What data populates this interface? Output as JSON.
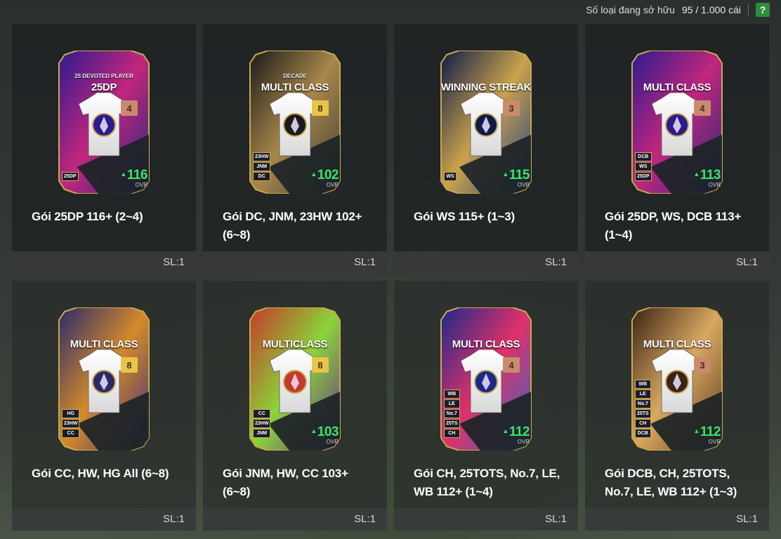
{
  "header": {
    "owned_label": "Số loại đang sở hữu",
    "owned_count": "95 / 1.000 cái",
    "help_label": "?"
  },
  "cards": [
    {
      "name": "Gói 25DP 116+ (2~4)",
      "pack_title": "25DP",
      "pack_sub": "25 DEVOTED PLAYER",
      "grade": "4",
      "ovr": "116",
      "ovr_label": "OVR",
      "tags": [
        "25DP"
      ],
      "quantity": "SL:1",
      "theme": [
        "#2c1b8f",
        "#c2267e",
        "#1b2a7a"
      ],
      "grade_color": "#c98b6b"
    },
    {
      "name": "Gói DC, JNM, 23HW 102+ (6~8)",
      "pack_title": "MULTI CLASS",
      "pack_sub": "DECADE",
      "grade": "8",
      "ovr": "102",
      "ovr_label": "OVR",
      "tags": [
        "23HW",
        "JNM",
        "DC"
      ],
      "quantity": "SL:1",
      "theme": [
        "#1a1a1a",
        "#a8874a",
        "#3a3a3a"
      ],
      "grade_color": "#e8c547"
    },
    {
      "name": "Gói WS 115+ (1~3)",
      "pack_title": "WINNING STREAK",
      "pack_sub": "",
      "grade": "3",
      "ovr": "115",
      "ovr_label": "OVR",
      "tags": [
        "WS"
      ],
      "quantity": "SL:1",
      "theme": [
        "#0e1a4a",
        "#c9a24a",
        "#1c3a8a"
      ],
      "grade_color": "#c98b6b"
    },
    {
      "name": "Gói 25DP, WS, DCB 113+ (1~4)",
      "pack_title": "MULTI CLASS",
      "pack_sub": "",
      "grade": "4",
      "ovr": "113",
      "ovr_label": "OVR",
      "tags": [
        "DCB",
        "WS",
        "25DP"
      ],
      "quantity": "SL:1",
      "theme": [
        "#2c1b8f",
        "#c2267e",
        "#1b2a7a"
      ],
      "grade_color": "#c98b6b"
    },
    {
      "name": "Gói CC, HW, HG All (6~8)",
      "pack_title": "MULTI CLASS",
      "pack_sub": "",
      "grade": "8",
      "ovr": "",
      "ovr_label": "",
      "tags": [
        "HG",
        "23HW",
        "CC"
      ],
      "quantity": "SL:1",
      "theme": [
        "#2a2a6a",
        "#d48a2a",
        "#3a2a7a"
      ],
      "grade_color": "#e8c547"
    },
    {
      "name": "Gói JNM, HW, CC 103+ (6~8)",
      "pack_title": "MULTICLASS",
      "pack_sub": "",
      "grade": "8",
      "ovr": "103",
      "ovr_label": "OVR",
      "tags": [
        "CC",
        "23HW",
        "JNM"
      ],
      "quantity": "SL:1",
      "theme": [
        "#c43a2a",
        "#8ad43a",
        "#6a2a8a"
      ],
      "grade_color": "#e8c547"
    },
    {
      "name": "Gói CH, 25TOTS, No.7, LE, WB 112+ (1~4)",
      "pack_title": "MULTI CLASS",
      "pack_sub": "",
      "grade": "4",
      "ovr": "112",
      "ovr_label": "OVR",
      "tags": [
        "WB",
        "LE",
        "No.7",
        "25TS",
        "CH"
      ],
      "quantity": "SL:1",
      "theme": [
        "#1a2a8a",
        "#e0306a",
        "#2a6ac8"
      ],
      "grade_color": "#c98b6b"
    },
    {
      "name": "Gói DCB, CH, 25TOTS, No.7, LE, WB 112+ (1~3)",
      "pack_title": "MULTI CLASS",
      "pack_sub": "",
      "grade": "3",
      "ovr": "112",
      "ovr_label": "OVR",
      "tags": [
        "WB",
        "LE",
        "No.7",
        "25TS",
        "CH",
        "DCB"
      ],
      "quantity": "SL:1",
      "theme": [
        "#3a2416",
        "#d9a860",
        "#5a3a22"
      ],
      "grade_color": "#c98b6b"
    }
  ]
}
